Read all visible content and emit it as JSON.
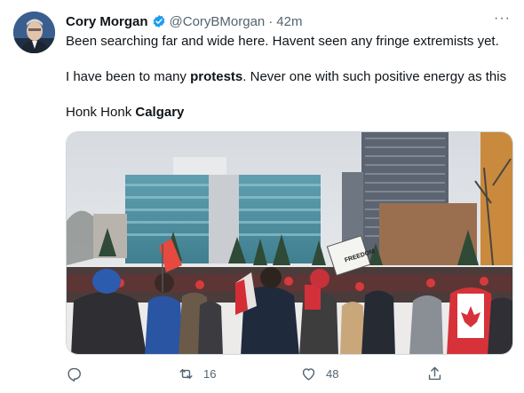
{
  "tweet": {
    "author_name": "Cory Morgan",
    "handle": "@CoryBMorgan",
    "separator": "·",
    "time": "42m",
    "more_label": "···",
    "line1": "Been searching far and wide here. Havent seen any fringe extremists yet.",
    "line2_before": "I have been to many ",
    "line2_bold": "protests",
    "line2_after": ". Never one with such positive energy as this",
    "line3_before": "Honk Honk ",
    "line3_bold": "Calgary"
  },
  "actions": {
    "reply_icon": "reply-icon",
    "retweet_icon": "retweet-icon",
    "retweet_count": "16",
    "like_icon": "heart-icon",
    "like_count": "48",
    "share_icon": "share-icon"
  },
  "photo": {
    "description_icon": "protest-photo",
    "sign_text": "FREEDOM"
  },
  "colors": {
    "verified_blue": "#1d9bf0",
    "secondary_text": "#536471",
    "primary_text": "#0f1419"
  }
}
